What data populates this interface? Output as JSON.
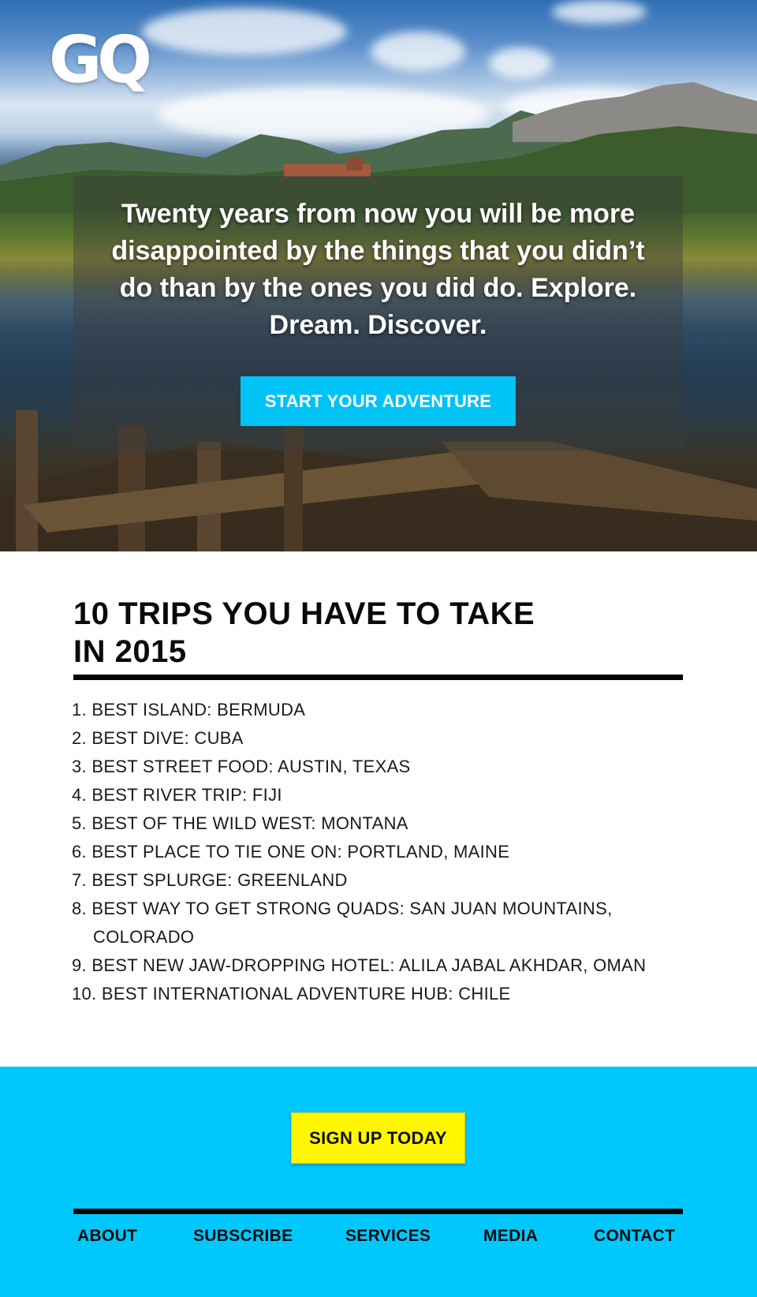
{
  "brand": {
    "logo_text": "GQ"
  },
  "hero": {
    "quote": "Twenty years from now you will be more disappointed by the things that you didn’t do than by the ones you did do. Explore. Dream. Discover.",
    "cta_label": "START YOUR ADVENTURE"
  },
  "trips": {
    "title": "10 TRIPS YOU HAVE TO TAKE IN 2015",
    "items": [
      {
        "text": "1. BEST ISLAND: BERMUDA"
      },
      {
        "text": "2. BEST DIVE: CUBA"
      },
      {
        "text": "3. BEST STREET FOOD: AUSTIN, TEXAS"
      },
      {
        "text": "4. BEST RIVER TRIP: FIJI"
      },
      {
        "text": "5. BEST OF THE WILD WEST: MONTANA"
      },
      {
        "text": "6. BEST PLACE TO TIE ONE ON: PORTLAND, MAINE"
      },
      {
        "text": "7. BEST SPLURGE: GREENLAND"
      },
      {
        "text": "8. BEST WAY TO GET STRONG QUADS: SAN JUAN MOUNTAINS,",
        "continuation": "COLORADO"
      },
      {
        "text": "9. BEST NEW JAW-DROPPING HOTEL: ALILA JABAL AKHDAR, OMAN"
      },
      {
        "text": "10. BEST INTERNATIONAL ADVENTURE HUB: CHILE"
      }
    ]
  },
  "footer": {
    "signup_label": "SIGN UP TODAY",
    "nav": [
      "ABOUT",
      "SUBSCRIBE",
      "SERVICES",
      "MEDIA",
      "CONTACT"
    ]
  },
  "colors": {
    "accent_blue": "#00c3f5",
    "footer_blue": "#00c8ff",
    "signup_yellow": "#fff600",
    "rule_black": "#000000"
  }
}
